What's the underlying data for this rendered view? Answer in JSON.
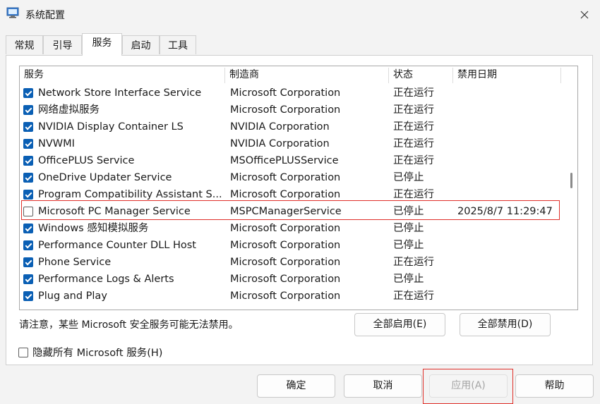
{
  "window": {
    "title": "系统配置"
  },
  "tabs": [
    {
      "label": "常规"
    },
    {
      "label": "引导"
    },
    {
      "label": "服务"
    },
    {
      "label": "启动"
    },
    {
      "label": "工具"
    }
  ],
  "table": {
    "columns": [
      "服务",
      "制造商",
      "状态",
      "禁用日期"
    ],
    "rows": [
      {
        "checked": true,
        "service": "Network Store Interface Service",
        "manufacturer": "Microsoft Corporation",
        "status": "正在运行",
        "disabled_date": ""
      },
      {
        "checked": true,
        "service": "网络虚拟服务",
        "manufacturer": "Microsoft Corporation",
        "status": "正在运行",
        "disabled_date": ""
      },
      {
        "checked": true,
        "service": "NVIDIA Display Container LS",
        "manufacturer": "NVIDIA Corporation",
        "status": "正在运行",
        "disabled_date": ""
      },
      {
        "checked": true,
        "service": "NVWMI",
        "manufacturer": "NVIDIA Corporation",
        "status": "正在运行",
        "disabled_date": ""
      },
      {
        "checked": true,
        "service": "OfficePLUS Service",
        "manufacturer": "MSOfficePLUSService",
        "status": "正在运行",
        "disabled_date": ""
      },
      {
        "checked": true,
        "service": "OneDrive Updater Service",
        "manufacturer": "Microsoft Corporation",
        "status": "已停止",
        "disabled_date": ""
      },
      {
        "checked": true,
        "service": "Program Compatibility Assistant S...",
        "manufacturer": "Microsoft Corporation",
        "status": "正在运行",
        "disabled_date": ""
      },
      {
        "checked": false,
        "service": "Microsoft PC Manager Service",
        "manufacturer": "MSPCManagerService",
        "status": "已停止",
        "disabled_date": "2025/8/7 11:29:47"
      },
      {
        "checked": true,
        "service": "Windows 感知模拟服务",
        "manufacturer": "Microsoft Corporation",
        "status": "已停止",
        "disabled_date": ""
      },
      {
        "checked": true,
        "service": "Performance Counter DLL Host",
        "manufacturer": "Microsoft Corporation",
        "status": "已停止",
        "disabled_date": ""
      },
      {
        "checked": true,
        "service": "Phone Service",
        "manufacturer": "Microsoft Corporation",
        "status": "正在运行",
        "disabled_date": ""
      },
      {
        "checked": true,
        "service": "Performance Logs & Alerts",
        "manufacturer": "Microsoft Corporation",
        "status": "已停止",
        "disabled_date": ""
      },
      {
        "checked": true,
        "service": "Plug and Play",
        "manufacturer": "Microsoft Corporation",
        "status": "正在运行",
        "disabled_date": ""
      }
    ]
  },
  "note": "请注意，某些 Microsoft 安全服务可能无法禁用。",
  "buttons": {
    "enable_all": "全部启用(E)",
    "disable_all": "全部禁用(D)",
    "ok": "确定",
    "cancel": "取消",
    "apply": "应用(A)",
    "help": "帮助"
  },
  "hide_ms": {
    "label": "隐藏所有 Microsoft 服务(H)",
    "checked": false
  },
  "colors": {
    "accent": "#0a5fb4",
    "highlight": "#e0302a"
  }
}
